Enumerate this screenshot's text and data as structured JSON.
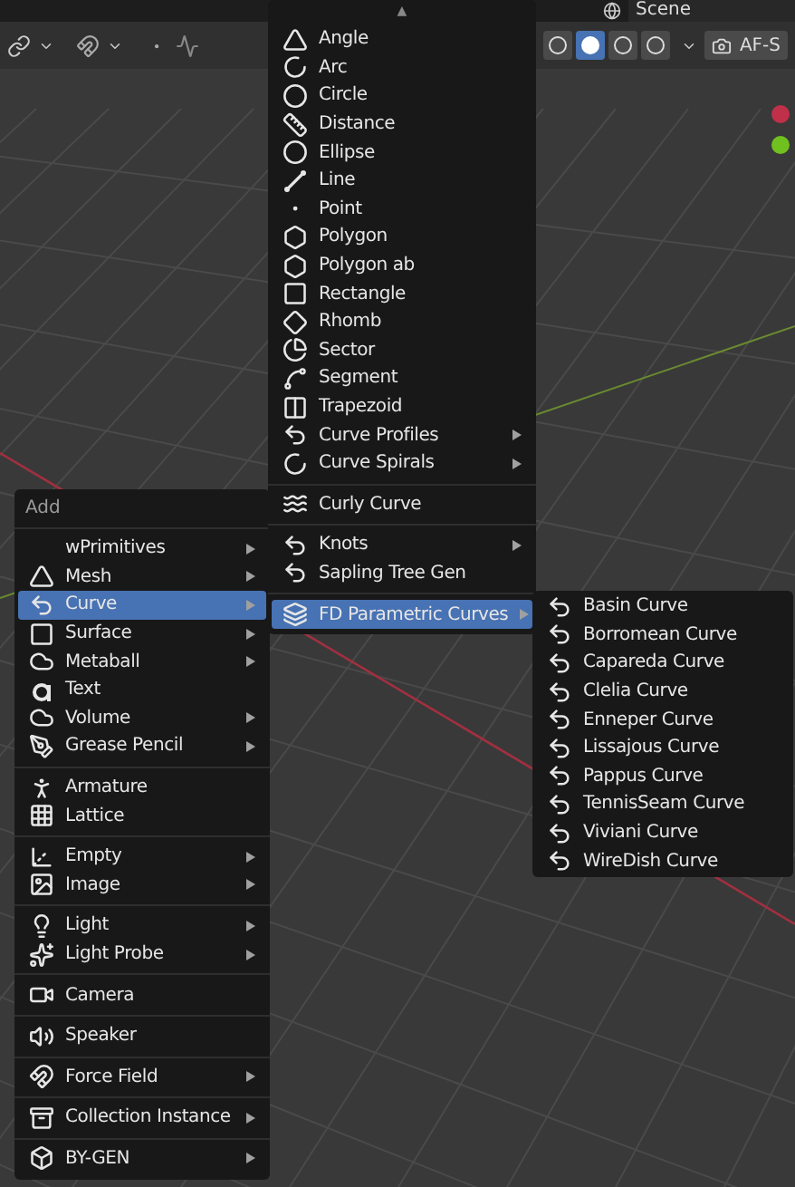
{
  "header": {
    "scene_field": "Scene",
    "shading_modes": [
      {
        "selected": false
      },
      {
        "selected": true
      },
      {
        "selected": false
      },
      {
        "selected": false
      }
    ],
    "af_button": "AF-S"
  },
  "add_menu": {
    "title": "Add",
    "groups": [
      [
        {
          "label": "wPrimitives",
          "submenu": true,
          "selected": false
        },
        {
          "label": "Mesh",
          "submenu": true,
          "selected": false
        },
        {
          "label": "Curve",
          "submenu": true,
          "selected": true
        },
        {
          "label": "Surface",
          "submenu": true,
          "selected": false
        },
        {
          "label": "Metaball",
          "submenu": true,
          "selected": false
        },
        {
          "label": "Text",
          "submenu": false,
          "selected": false
        },
        {
          "label": "Volume",
          "submenu": true,
          "selected": false
        },
        {
          "label": "Grease Pencil",
          "submenu": true,
          "selected": false
        }
      ],
      [
        {
          "label": "Armature",
          "submenu": false,
          "selected": false
        },
        {
          "label": "Lattice",
          "submenu": false,
          "selected": false
        }
      ],
      [
        {
          "label": "Empty",
          "submenu": true,
          "selected": false
        },
        {
          "label": "Image",
          "submenu": true,
          "selected": false
        }
      ],
      [
        {
          "label": "Light",
          "submenu": true,
          "selected": false
        },
        {
          "label": "Light Probe",
          "submenu": true,
          "selected": false
        }
      ],
      [
        {
          "label": "Camera",
          "submenu": false,
          "selected": false
        }
      ],
      [
        {
          "label": "Speaker",
          "submenu": false,
          "selected": false
        }
      ],
      [
        {
          "label": "Force Field",
          "submenu": true,
          "selected": false
        }
      ],
      [
        {
          "label": "Collection Instance",
          "submenu": true,
          "selected": false
        }
      ],
      [
        {
          "label": "BY-GEN",
          "submenu": true,
          "selected": false
        }
      ]
    ]
  },
  "curve_menu": {
    "scroll_up": "▲",
    "groups": [
      [
        {
          "label": "Angle",
          "submenu": false,
          "selected": false
        },
        {
          "label": "Arc",
          "submenu": false,
          "selected": false
        },
        {
          "label": "Circle",
          "submenu": false,
          "selected": false
        },
        {
          "label": "Distance",
          "submenu": false,
          "selected": false
        },
        {
          "label": "Ellipse",
          "submenu": false,
          "selected": false
        },
        {
          "label": "Line",
          "submenu": false,
          "selected": false
        },
        {
          "label": "Point",
          "submenu": false,
          "selected": false
        },
        {
          "label": "Polygon",
          "submenu": false,
          "selected": false
        },
        {
          "label": "Polygon ab",
          "submenu": false,
          "selected": false
        },
        {
          "label": "Rectangle",
          "submenu": false,
          "selected": false
        },
        {
          "label": "Rhomb",
          "submenu": false,
          "selected": false
        },
        {
          "label": "Sector",
          "submenu": false,
          "selected": false
        },
        {
          "label": "Segment",
          "submenu": false,
          "selected": false
        },
        {
          "label": "Trapezoid",
          "submenu": false,
          "selected": false
        },
        {
          "label": "Curve Profiles",
          "submenu": true,
          "selected": false
        },
        {
          "label": "Curve Spirals",
          "submenu": true,
          "selected": false
        }
      ],
      [
        {
          "label": "Curly Curve",
          "submenu": false,
          "selected": false
        }
      ],
      [
        {
          "label": "Knots",
          "submenu": true,
          "selected": false
        },
        {
          "label": "Sapling Tree Gen",
          "submenu": false,
          "selected": false
        }
      ],
      [
        {
          "label": "FD Parametric Curves",
          "submenu": true,
          "selected": true
        }
      ]
    ]
  },
  "fd_menu": {
    "items": [
      {
        "label": "Basin Curve",
        "selected": false
      },
      {
        "label": "Borromean Curve",
        "selected": false
      },
      {
        "label": "Capareda Curve",
        "selected": false
      },
      {
        "label": "Clelia Curve",
        "selected": false
      },
      {
        "label": "Enneper Curve",
        "selected": false
      },
      {
        "label": "Lissajous Curve",
        "selected": false
      },
      {
        "label": "Pappus Curve",
        "selected": false
      },
      {
        "label": "TennisSeam Curve",
        "selected": false
      },
      {
        "label": "Viviani Curve",
        "selected": false
      },
      {
        "label": "WireDish Curve",
        "selected": false
      }
    ]
  }
}
